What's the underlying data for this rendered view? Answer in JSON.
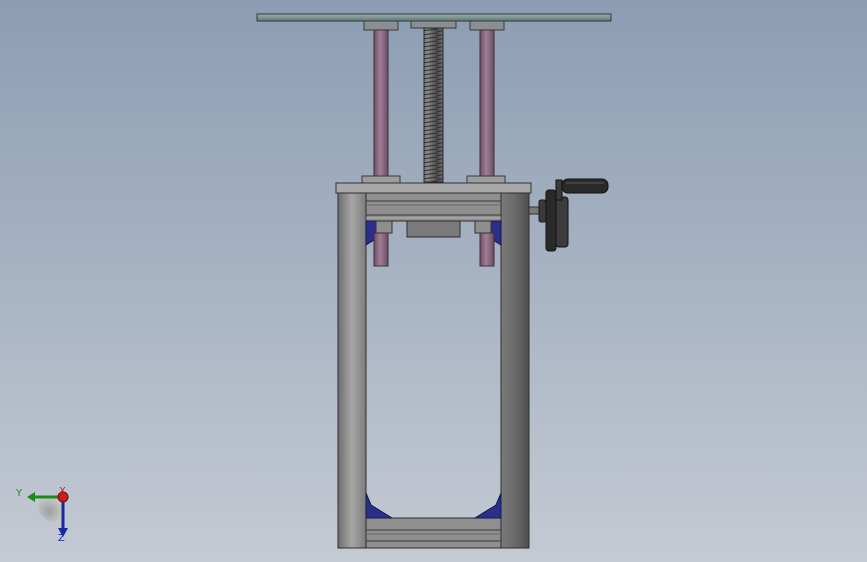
{
  "triad": {
    "y_label": "Y",
    "x_label": "X",
    "z_label": "Z"
  },
  "colors": {
    "bg_top": "#8c9db3",
    "bg_bottom": "#c3c9d3",
    "plate_fill": "#7d9594",
    "rod_fill": "#8c6780",
    "screw_fill": "#6d6d6d",
    "frame_fill": "#8a8a8a",
    "frame_dark": "#5a5a5a",
    "bracket_blue": "#2a2f8a",
    "handle_dark": "#2a2a2a",
    "axis_y": "#1a8a1a",
    "axis_x": "#c81e1e",
    "axis_z": "#1a2a9a"
  }
}
